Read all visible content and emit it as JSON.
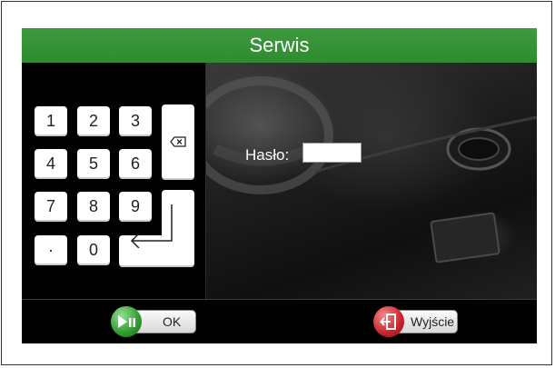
{
  "window": {
    "title": "Serwis"
  },
  "keypad": {
    "keys": [
      "1",
      "2",
      "3",
      "4",
      "5",
      "6",
      "7",
      "8",
      "9",
      "·",
      "0"
    ],
    "backspace_icon": "backspace-icon",
    "enter_icon": "enter-arrow-icon"
  },
  "password": {
    "label": "Hasło:",
    "value": ""
  },
  "footer": {
    "ok_label": "OK",
    "ok_icon": "play-pause-icon",
    "exit_label": "Wyjście",
    "exit_icon": "exit-door-icon"
  },
  "colors": {
    "title_bar": "#2e8b2e",
    "ok_icon": "#3aa63a",
    "exit_icon": "#c8242a"
  }
}
